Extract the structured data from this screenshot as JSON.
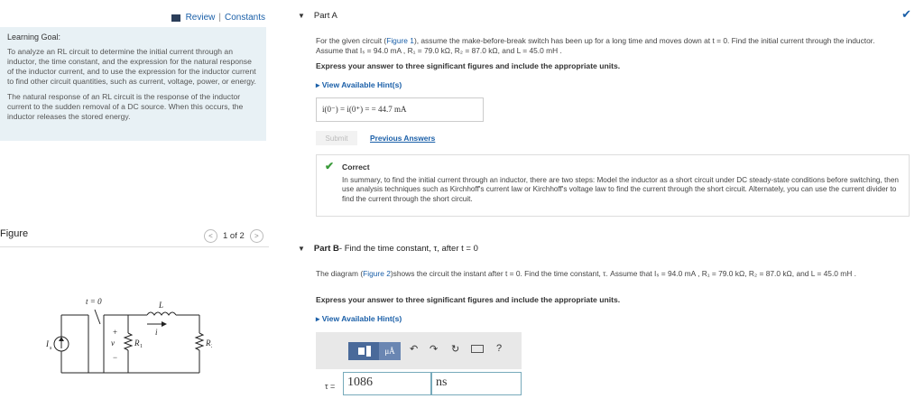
{
  "topbar": {
    "review": "Review",
    "separator": "|",
    "constants": "Constants"
  },
  "learning_goal": {
    "title": "Learning Goal:",
    "p1": "To analyze an RL circuit to determine the initial current through an inductor, the time constant, and the expression for the natural response of the inductor current, and to use the expression for the inductor current to find other circuit quantities, such as current, voltage, power, or energy.",
    "p2": "The natural response of an RL circuit is the response of the inductor current to the sudden removal of a DC source. When this occurs, the inductor releases the stored energy."
  },
  "figure": {
    "label": "Figure",
    "pager": "1 of 2",
    "prev": "<",
    "next": ">",
    "labels": {
      "switch": "t = 0",
      "inductor": "L",
      "current": "i",
      "source": "I",
      "source_sub": "s",
      "voltage": "v",
      "plus": "+",
      "minus": "−",
      "r1": "R",
      "r1_sub": "1",
      "r2": "R",
      "r2_sub": "2"
    }
  },
  "part_a": {
    "heading": "Part A",
    "question_1": "For the given circuit (",
    "figure_link": "Figure 1",
    "question_2": "), assume the make-before-break switch has been up for a long time and moves down at t = 0. Find the initial current through the inductor. Assume that Iₛ = 94.0 mA , R₁ = 79.0 kΩ, R₂ = 87.0 kΩ, and L = 45.0 mH .",
    "instruction": "Express your answer to three significant figures and include the appropriate units.",
    "hints": "▸ View Available Hint(s)",
    "answer": "i(0⁻) = i(0⁺) = = 44.7 mA",
    "submit": "Submit",
    "previous_answers": "Previous Answers",
    "check": "✔",
    "correct_title": "Correct",
    "correct_text": "In summary, to find the initial current through an inductor, there are two steps: Model the inductor as a short circuit under DC steady-state conditions before switching, then use analysis techniques such as Kirchhoff's current law or Kirchhoff's voltage law to find the current through the short circuit. Alternately, you can use the current divider to find the current through the short circuit."
  },
  "part_b": {
    "heading": "Part B",
    "heading_rest": " - Find the time constant, τ, after t = 0",
    "question_1": "The diagram (",
    "figure_link": "Figure 2",
    "question_2": ")shows the circuit the instant after t = 0. Find the time constant, τ. Assume that Iₛ = 94.0 mA , R₁ = 79.0 kΩ, R₂ = 87.0 kΩ, and L = 45.0 mH .",
    "instruction": "Express your answer to three significant figures and include the appropriate units.",
    "hints": "▸ View Available Hint(s)",
    "toolbar_mu": "μÅ",
    "toolbar_help": "?",
    "tau_label": "τ =",
    "value": "1086",
    "unit": "ns"
  }
}
